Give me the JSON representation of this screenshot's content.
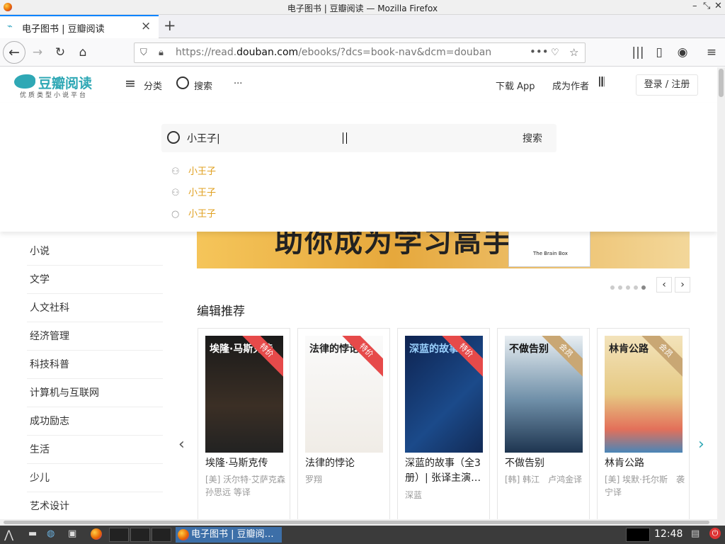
{
  "window": {
    "title": "电子图书 | 豆瓣阅读 — Mozilla Firefox"
  },
  "tab": {
    "title": "电子图书 | 豆瓣阅读"
  },
  "urlbar": {
    "url_prefix": "https://read.",
    "url_domain": "douban.com",
    "url_suffix": "/ebooks/?dcs=book-nav&dcm=douban"
  },
  "header": {
    "logo_name": "豆瓣阅读",
    "logo_sub": "优质类型小说平台",
    "categories": "分类",
    "search": "搜索",
    "more": "···",
    "download_app": "下载 App",
    "become_author": "成为作者",
    "login": "登录 / 注册"
  },
  "search": {
    "query": "小王子|",
    "button": "搜索",
    "suggestions": [
      {
        "icon": "user-icon",
        "text": "小王子"
      },
      {
        "icon": "user-icon",
        "text": "小王子"
      },
      {
        "icon": "search-icon",
        "text": "小王子"
      }
    ]
  },
  "sidebar": {
    "categories": [
      "小说",
      "文学",
      "人文社科",
      "经济管理",
      "科技科普",
      "计算机与互联网",
      "成功励志",
      "生活",
      "少儿",
      "艺术设计"
    ]
  },
  "banner": {
    "text": "助你成为学习高手",
    "book_title": "The Brain Box"
  },
  "section": {
    "title": "编辑推荐"
  },
  "books": [
    {
      "title": "埃隆·马斯克传",
      "author": "[美] 沃尔特·艾萨克森 孙思远 等译",
      "badge": "特价",
      "cover_text": "埃隆·马斯克传",
      "badge_color": "#e64a4a"
    },
    {
      "title": "法律的悖论",
      "author": "罗翔",
      "badge": "特价",
      "cover_text": "法律的悖论",
      "badge_color": "#e64a4a"
    },
    {
      "title": "深蓝的故事（全3册）| 张译主演…",
      "author": "深蓝",
      "badge": "特价",
      "cover_text": "深蓝的故事",
      "badge_color": "#e64a4a"
    },
    {
      "title": "不做告别",
      "author": "[韩] 韩江　卢鸿金译",
      "badge": "会员",
      "cover_text": "不做告别",
      "badge_color": "#c9a774"
    },
    {
      "title": "林肯公路",
      "author": "[美] 埃默·托尔斯　袭宁译",
      "badge": "会员",
      "cover_text": "林肯公路",
      "badge_color": "#c9a774"
    }
  ],
  "taskbar": {
    "task_label": "电子图书 | 豆瓣阅…",
    "clock": "12:48"
  }
}
